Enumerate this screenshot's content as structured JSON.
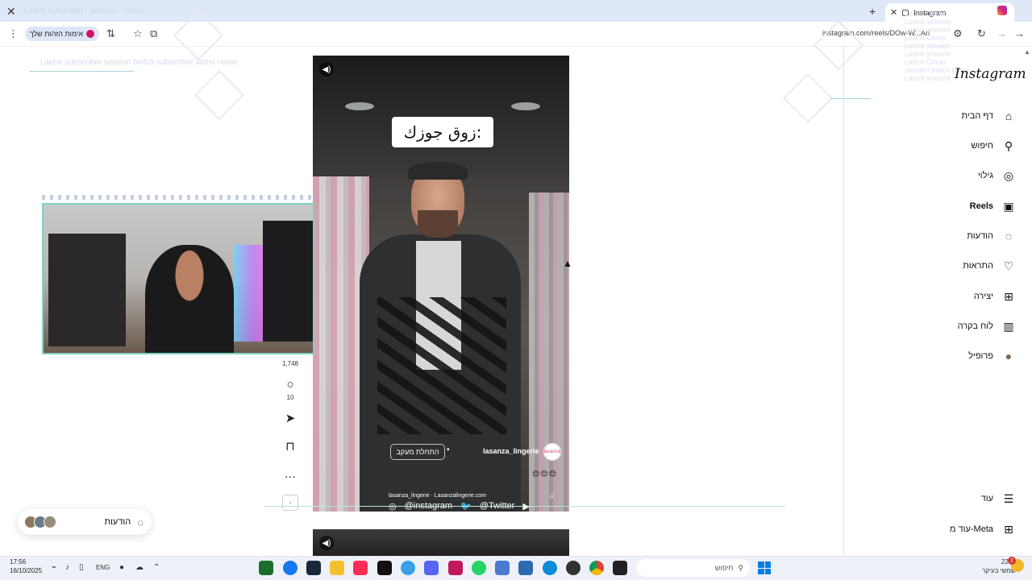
{
  "browser": {
    "tab_title": "Instagram",
    "ghost_tab_text": "Latest subscriber · session · twitch · ...",
    "url": "instagram.com/reels/DOw-W...Ar/",
    "badge_label": "אימות הזהות שלך"
  },
  "overlay": {
    "top_left_ghost": "Latest subscriber session twitch subscriber latest name",
    "right_ghost_lines": [
      "Latest Cheer",
      "Latest session",
      "Latest amount",
      "Latest Cheer",
      "Latest session",
      "Latest amount",
      "Latest Cheer",
      "session twitch cheer",
      "Latest amount"
    ]
  },
  "sidebar": {
    "logo": "Instagram",
    "items": [
      {
        "label": "דף הבית",
        "icon": "home-icon",
        "glyph": "⌂"
      },
      {
        "label": "חיפוש",
        "icon": "search-icon",
        "glyph": "⚲"
      },
      {
        "label": "גילוי",
        "icon": "compass-icon",
        "glyph": "◎"
      },
      {
        "label": "Reels",
        "icon": "reels-icon",
        "glyph": "▣"
      },
      {
        "label": "הודעות",
        "icon": "messenger-icon",
        "glyph": "◌"
      },
      {
        "label": "התראות",
        "icon": "heart-icon",
        "glyph": "♡"
      },
      {
        "label": "יצירה",
        "icon": "plus-square-icon",
        "glyph": "⊞"
      },
      {
        "label": "לוח בקרה",
        "icon": "dashboard-icon",
        "glyph": "▥"
      },
      {
        "label": "פרופיל",
        "icon": "profile-avatar-icon",
        "glyph": "●"
      }
    ],
    "more": {
      "label": "עוד",
      "glyph": "☰"
    },
    "meta": {
      "label": "עוד מ-Meta",
      "glyph": "⊞"
    }
  },
  "reel": {
    "caption": "زوق جوزك:",
    "username": "lasanza_lingerie",
    "follow_label": "התחלת מעקב",
    "audio_line": "lasanza_lingerie · Lasanzalingerie.com",
    "emojis": "😊😊😊",
    "socials": [
      "@instagram",
      "@Twitter"
    ]
  },
  "actions": {
    "likes": "1,748",
    "comments": "10"
  },
  "messages": {
    "label": "הודעות"
  },
  "taskbar": {
    "time": "17:56",
    "date": "16/10/2025",
    "lang": "ENG",
    "search_placeholder": "חיפוש",
    "weather_temp": "22°C",
    "weather_desc": "שמשי בעיקר",
    "notif_count": "2"
  },
  "colors": {
    "tab_bg": "#dfe8f6",
    "accent_teal": "#7fd0c3",
    "instagram_pink": "#d62976"
  }
}
